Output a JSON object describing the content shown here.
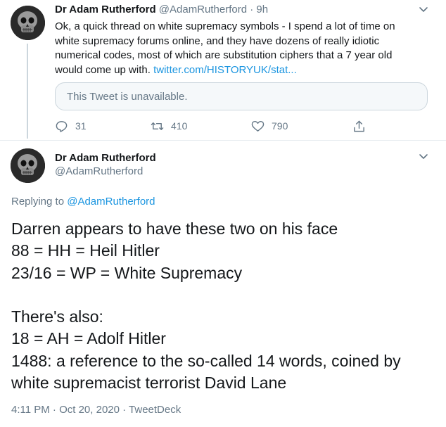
{
  "tweet1": {
    "display_name": "Dr Adam Rutherford",
    "handle": "@AdamRutherford",
    "separator": "·",
    "time_ago": "9h",
    "text_lines": [
      "Ok, a quick thread on white supremacy symbols - I spend a lot of time on",
      "white supremacy forums online, and they have dozens of really idiotic",
      "numerical codes, most of which are substitution ciphers that a 7 year old"
    ],
    "text_last": "would come up with.",
    "link": "twitter.com/HISTORYUK/stat...",
    "quoted_tweet": "This Tweet is unavailable.",
    "actions": {
      "replies": "31",
      "retweets": "410",
      "likes": "790"
    }
  },
  "tweet2": {
    "display_name": "Dr Adam Rutherford",
    "handle": "@AdamRutherford",
    "replying_prefix": "Replying to",
    "replying_handle": "@AdamRutherford",
    "text_lines": [
      "Darren appears to have these two on his face",
      "88 = HH = Heil Hitler",
      "23/16 = WP = White Supremacy",
      "",
      "There's also:",
      "18 = AH = Adolf Hitler",
      "1488: a reference to the so-called 14 words, coined by",
      "white supremacist terrorist David Lane"
    ],
    "timestamp": "4:11 PM · Oct 20, 2020 · TweetDeck"
  },
  "colors": {
    "link": "#1b95e0",
    "muted": "#657786",
    "border": "#ccd6dd"
  },
  "icons": [
    "skull-avatar",
    "chevron-down-icon",
    "reply-icon",
    "retweet-icon",
    "like-icon",
    "share-icon"
  ]
}
